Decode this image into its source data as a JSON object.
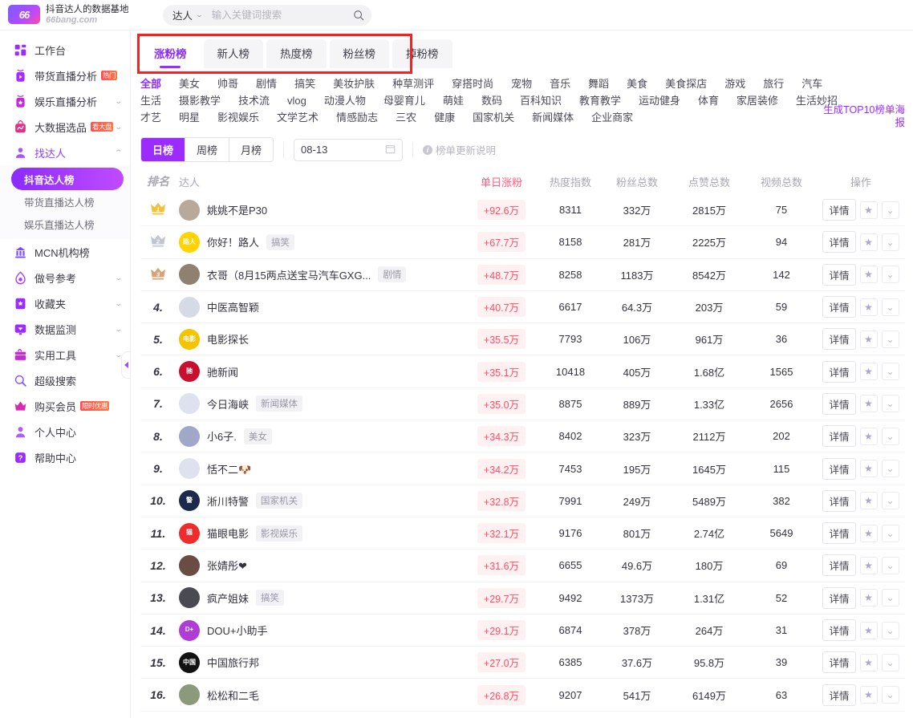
{
  "brand": {
    "logo_text": "66",
    "title": "抖音达人的数据基地",
    "subtitle": "66bang.com"
  },
  "search": {
    "scope": "达人",
    "placeholder": "输入关键词搜索",
    "value": "",
    "icon": "search-icon"
  },
  "sidebar": {
    "items": [
      {
        "label": "工作台",
        "icon": "dashboard-icon",
        "color": "#9b2bff",
        "arrow": "",
        "badge": ""
      },
      {
        "label": "带货直播分析",
        "icon": "live-video-icon",
        "color": "#a62bff",
        "arrow": "",
        "badge": "热门"
      },
      {
        "label": "娱乐直播分析",
        "icon": "star-live-icon",
        "color": "#c02bd6",
        "arrow": "⌄",
        "badge": ""
      },
      {
        "label": "大数据选品",
        "icon": "bag-chart-icon",
        "color": "#e0308a",
        "arrow": "⌄",
        "badge": "看大盘"
      },
      {
        "label": "找达人",
        "icon": "person-search-icon",
        "color": "#a855ff",
        "arrow": "⌃",
        "badge": "",
        "active": true
      }
    ],
    "subitems": [
      {
        "label": "抖音达人榜",
        "selected": true
      },
      {
        "label": "带货直播达人榜",
        "selected": false
      },
      {
        "label": "娱乐直播达人榜",
        "selected": false
      }
    ],
    "items2": [
      {
        "label": "MCN机构榜",
        "icon": "building-icon",
        "color": "#7b4bff",
        "arrow": "",
        "badge": ""
      },
      {
        "label": "做号参考",
        "icon": "flame-drop-icon",
        "color": "#a83bff",
        "arrow": "⌄",
        "badge": ""
      },
      {
        "label": "收藏夹",
        "icon": "bookmark-star-icon",
        "color": "#9b2bff",
        "arrow": "⌄",
        "badge": ""
      },
      {
        "label": "数据监测",
        "icon": "monitor-icon",
        "color": "#9b2bff",
        "arrow": "⌄",
        "badge": ""
      },
      {
        "label": "实用工具",
        "icon": "toolbox-icon",
        "color": "#c32bd6",
        "arrow": "⌄",
        "badge": ""
      },
      {
        "label": "超级搜索",
        "icon": "magnifier-icon",
        "color": "#8a4bff",
        "arrow": "",
        "badge": ""
      },
      {
        "label": "购买会员",
        "icon": "crown-icon",
        "color": "#d62bb0",
        "arrow": "",
        "badge": "限时优惠"
      },
      {
        "label": "个人中心",
        "icon": "user-icon",
        "color": "#b05bff",
        "arrow": "",
        "badge": ""
      },
      {
        "label": "帮助中心",
        "icon": "help-icon",
        "color": "#9b2bff",
        "arrow": "",
        "badge": ""
      }
    ],
    "collapse": "collapse-sidebar-handle"
  },
  "tabs": [
    {
      "label": "涨粉榜",
      "active": true
    },
    {
      "label": "新人榜",
      "active": false
    },
    {
      "label": "热度榜",
      "active": false
    },
    {
      "label": "粉丝榜",
      "active": false
    },
    {
      "label": "掉粉榜",
      "active": false
    }
  ],
  "categories": {
    "row1": [
      "全部",
      "美女",
      "帅哥",
      "剧情",
      "搞笑",
      "美妆护肤",
      "种草测评",
      "穿搭时尚",
      "宠物",
      "音乐",
      "舞蹈",
      "美食",
      "美食探店",
      "游戏",
      "旅行",
      "汽车"
    ],
    "row2": [
      "生活",
      "摄影教学",
      "技术流",
      "vlog",
      "动漫人物",
      "母婴育儿",
      "萌娃",
      "数码",
      "百科知识",
      "教育教学",
      "运动健身",
      "体育",
      "家居装修",
      "生活妙招"
    ],
    "row3": [
      "才艺",
      "明星",
      "影视娱乐",
      "文学艺术",
      "情感励志",
      "三农",
      "健康",
      "国家机关",
      "新闻媒体",
      "企业商家"
    ],
    "selected": "全部"
  },
  "poster_link": "生成TOP10榜单海报",
  "filters": {
    "periods": [
      {
        "label": "日榜",
        "on": true
      },
      {
        "label": "周榜",
        "on": false
      },
      {
        "label": "月榜",
        "on": false
      }
    ],
    "date": "08-13",
    "date_icon": "calendar-icon",
    "note": "榜单更新说明",
    "note_icon": "info-icon"
  },
  "table": {
    "headers": {
      "rank": "排名",
      "name": "达人",
      "grow": "单日涨粉",
      "heat": "热度指数",
      "fans": "粉丝总数",
      "likes": "点赞总数",
      "videos": "视频总数",
      "ops": "操作"
    },
    "op_detail": "详情",
    "op_star_icon": "star-icon",
    "op_more_icon": "chevron-down-icon",
    "rows": [
      {
        "rank": "1",
        "medal": "gold",
        "name": "姚姚不是P30",
        "tag": "",
        "avatar_color": "#b8a99a",
        "avatar_text": "",
        "grow": "+92.6万",
        "heat": "8311",
        "fans": "332万",
        "likes": "2815万",
        "videos": "75"
      },
      {
        "rank": "2",
        "medal": "silver",
        "name": "你好！路人",
        "tag": "搞笑",
        "avatar_color": "#ffd400",
        "avatar_text": "路人",
        "grow": "+67.7万",
        "heat": "8158",
        "fans": "281万",
        "likes": "2225万",
        "videos": "94"
      },
      {
        "rank": "3",
        "medal": "bronze",
        "name": "衣哥（8月15两点送宝马汽车GXG...",
        "tag": "剧情",
        "avatar_color": "#8f8070",
        "avatar_text": "",
        "grow": "+48.7万",
        "heat": "8258",
        "fans": "1183万",
        "likes": "8542万",
        "videos": "142"
      },
      {
        "rank": "4.",
        "medal": "",
        "name": "中医高智颖",
        "tag": "",
        "avatar_color": "#d6dae6",
        "avatar_text": "",
        "grow": "+40.7万",
        "heat": "6617",
        "fans": "64.3万",
        "likes": "203万",
        "videos": "59"
      },
      {
        "rank": "5.",
        "medal": "",
        "name": "电影探长",
        "tag": "",
        "avatar_color": "#f5c400",
        "avatar_text": "电影",
        "grow": "+35.5万",
        "heat": "7793",
        "fans": "106万",
        "likes": "961万",
        "videos": "36"
      },
      {
        "rank": "6.",
        "medal": "",
        "name": "驰新闻",
        "tag": "",
        "avatar_color": "#c8102e",
        "avatar_text": "驰",
        "grow": "+35.1万",
        "heat": "10418",
        "fans": "405万",
        "likes": "1.68亿",
        "videos": "1565"
      },
      {
        "rank": "7.",
        "medal": "",
        "name": "今日海峡",
        "tag": "新闻媒体",
        "avatar_color": "#dde2ee",
        "avatar_text": "",
        "grow": "+35.0万",
        "heat": "8875",
        "fans": "889万",
        "likes": "1.33亿",
        "videos": "2656"
      },
      {
        "rank": "8.",
        "medal": "",
        "name": "小6子.",
        "tag": "美女",
        "avatar_color": "#9fa8c8",
        "avatar_text": "",
        "grow": "+34.3万",
        "heat": "8402",
        "fans": "323万",
        "likes": "2112万",
        "videos": "202"
      },
      {
        "rank": "9.",
        "medal": "",
        "name": "恬不二🐶",
        "tag": "",
        "avatar_color": "#dde2ee",
        "avatar_text": "",
        "grow": "+34.2万",
        "heat": "7453",
        "fans": "195万",
        "likes": "1645万",
        "videos": "115"
      },
      {
        "rank": "10.",
        "medal": "",
        "name": "淅川特警",
        "tag": "国家机关",
        "avatar_color": "#1b2a4a",
        "avatar_text": "警",
        "grow": "+32.8万",
        "heat": "7991",
        "fans": "249万",
        "likes": "5489万",
        "videos": "382"
      },
      {
        "rank": "11.",
        "medal": "",
        "name": "猫眼电影",
        "tag": "影视娱乐",
        "avatar_color": "#ef2b2b",
        "avatar_text": "猫",
        "grow": "+32.1万",
        "heat": "9176",
        "fans": "801万",
        "likes": "2.74亿",
        "videos": "5649"
      },
      {
        "rank": "12.",
        "medal": "",
        "name": "张婧彤❤",
        "tag": "",
        "avatar_color": "#6b4c45",
        "avatar_text": "",
        "grow": "+31.6万",
        "heat": "6655",
        "fans": "49.6万",
        "likes": "180万",
        "videos": "69"
      },
      {
        "rank": "13.",
        "medal": "",
        "name": "疯产姐妹",
        "tag": "搞笑",
        "avatar_color": "#4a4a52",
        "avatar_text": "",
        "grow": "+29.7万",
        "heat": "9492",
        "fans": "1373万",
        "likes": "1.31亿",
        "videos": "52"
      },
      {
        "rank": "14.",
        "medal": "",
        "name": "DOU+小助手",
        "tag": "",
        "avatar_color": "#b03cd8",
        "avatar_text": "D+",
        "grow": "+29.1万",
        "heat": "6874",
        "fans": "378万",
        "likes": "264万",
        "videos": "31"
      },
      {
        "rank": "15.",
        "medal": "",
        "name": "中国旅行邦",
        "tag": "",
        "avatar_color": "#111111",
        "avatar_text": "中国",
        "grow": "+27.0万",
        "heat": "6385",
        "fans": "37.6万",
        "likes": "95.8万",
        "videos": "39"
      },
      {
        "rank": "16.",
        "medal": "",
        "name": "松松和二毛",
        "tag": "",
        "avatar_color": "#8a9a7a",
        "avatar_text": "",
        "grow": "+26.8万",
        "heat": "9207",
        "fans": "541万",
        "likes": "6149万",
        "videos": "63"
      }
    ]
  }
}
